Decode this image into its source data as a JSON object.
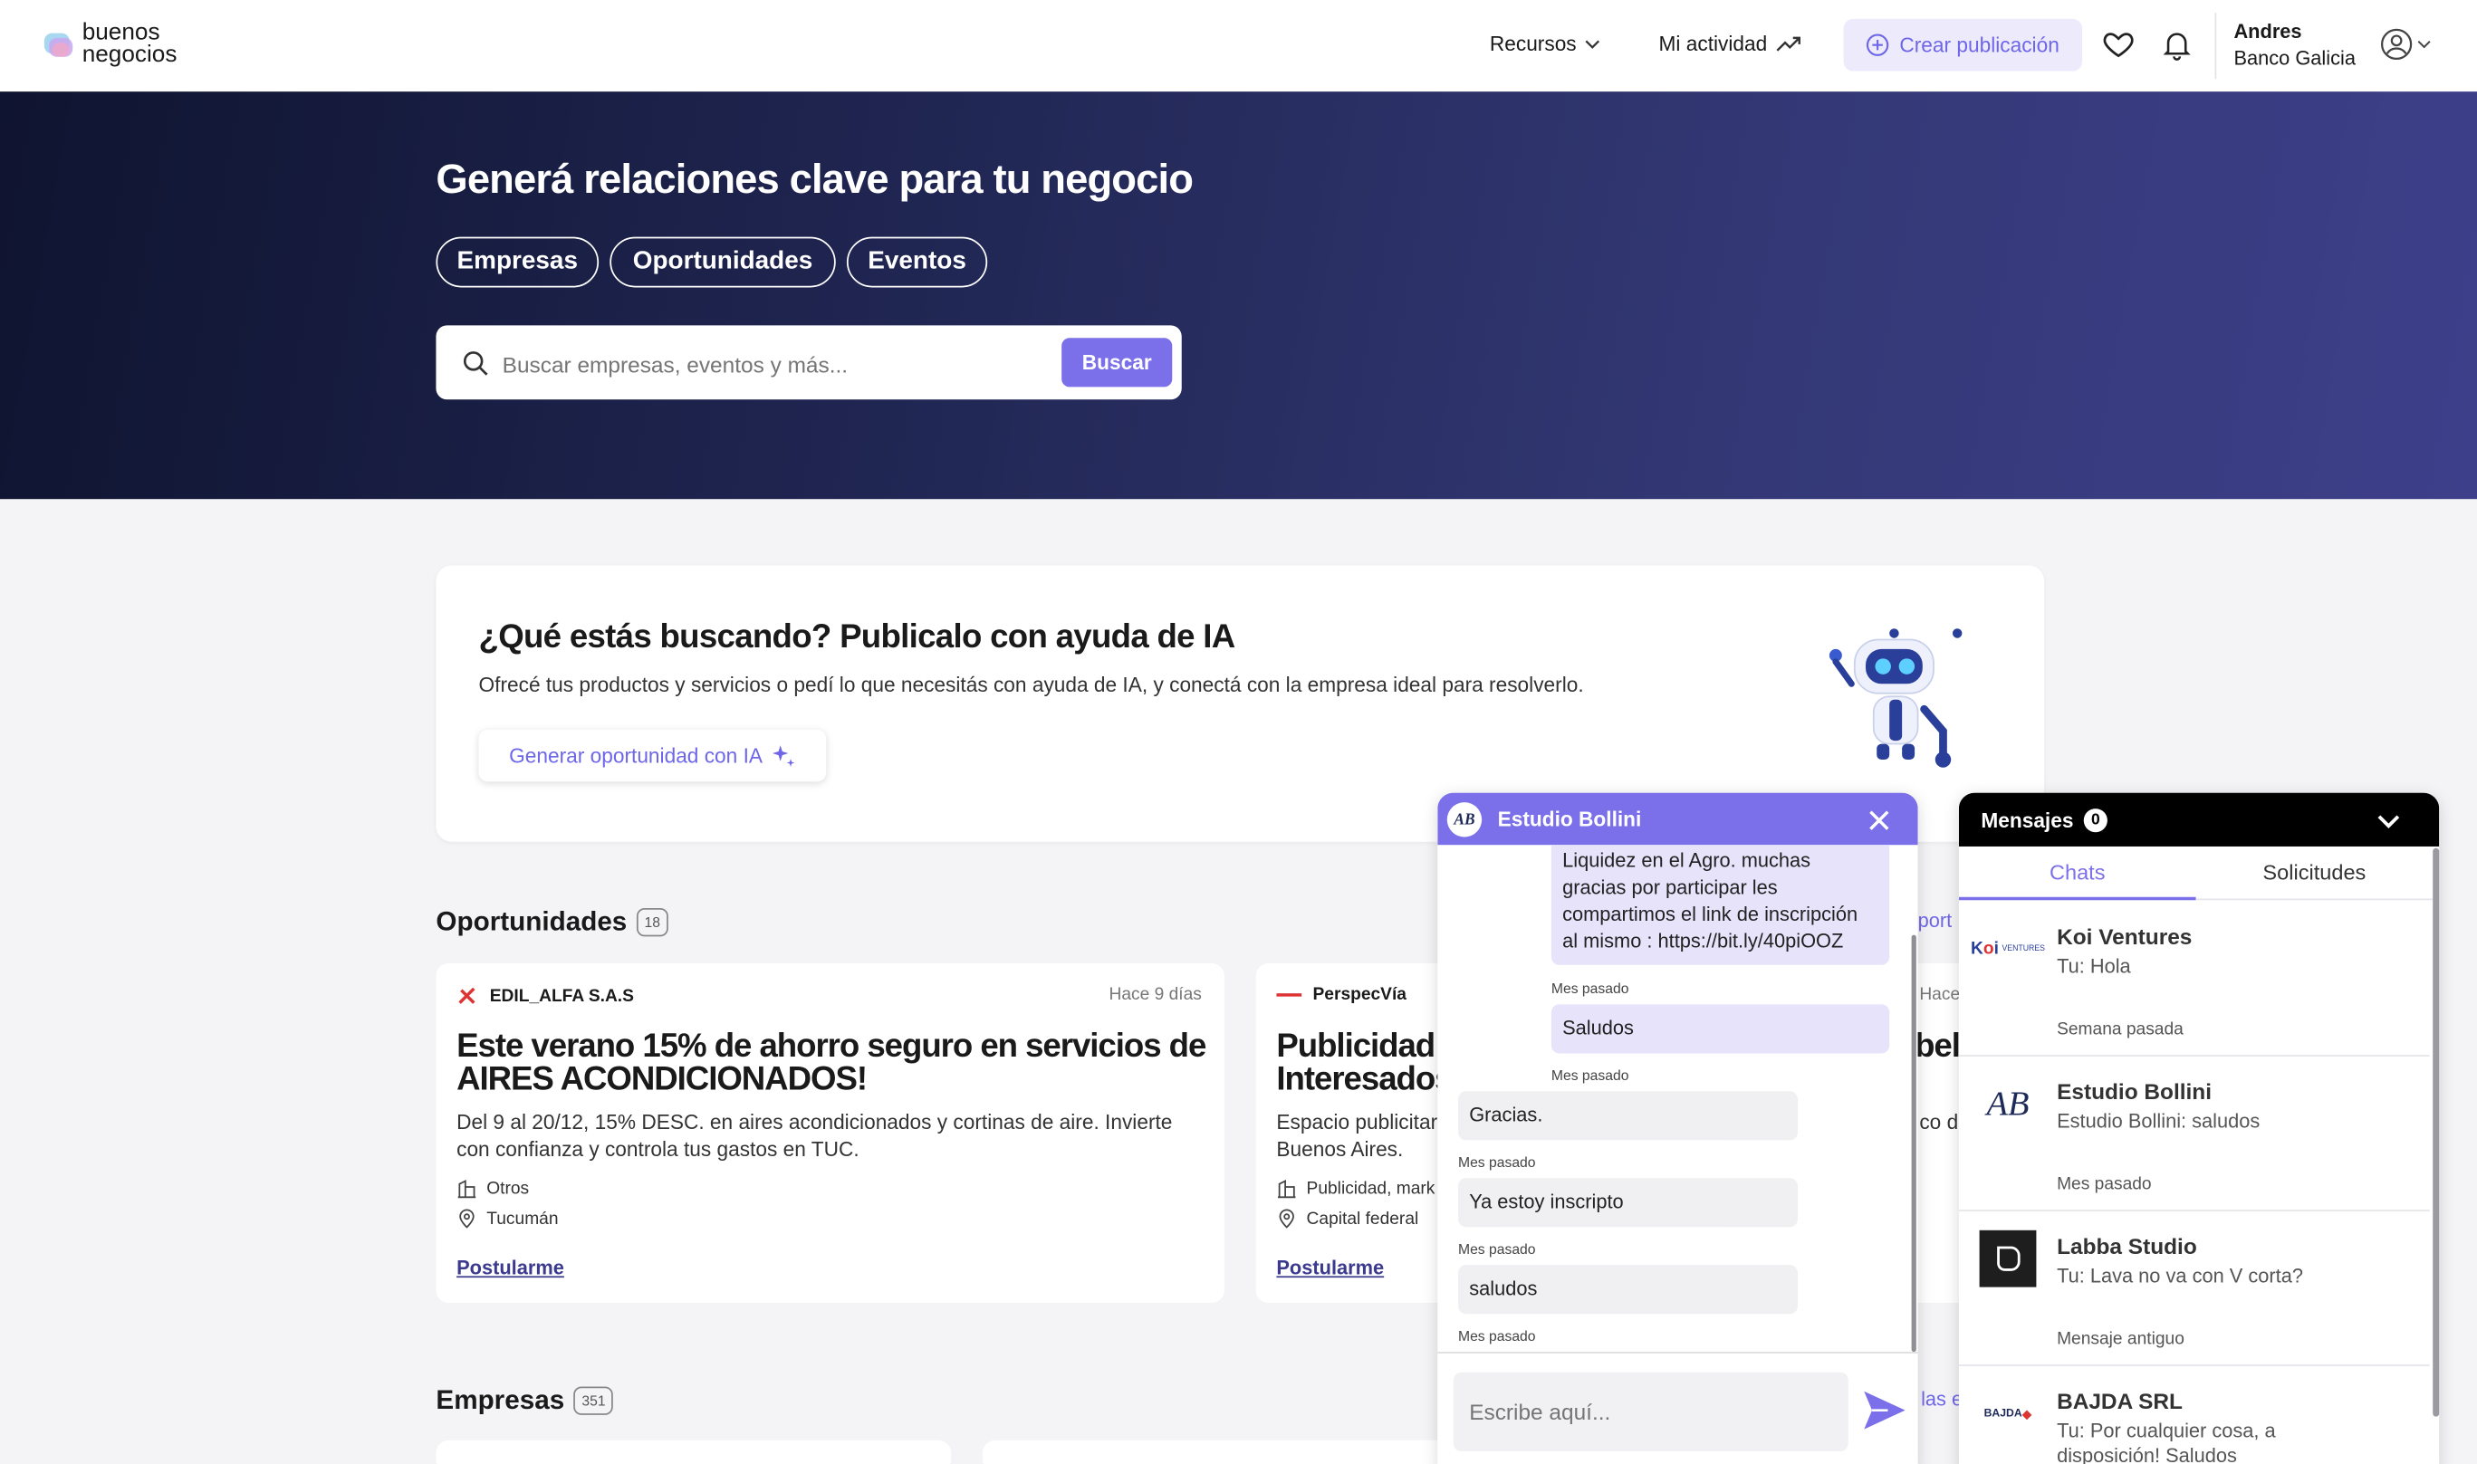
{
  "header": {
    "logo_line1": "buenos",
    "logo_line2": "negocios",
    "nav_resources": "Recursos",
    "nav_activity": "Mi actividad",
    "create_label": "Crear publicación",
    "user_name": "Andres",
    "user_company": "Banco Galicia"
  },
  "hero": {
    "title": "Generá relaciones clave para tu negocio",
    "tabs": [
      "Empresas",
      "Oportunidades",
      "Eventos"
    ],
    "search_placeholder": "Buscar empresas, eventos y más...",
    "search_button": "Buscar"
  },
  "ai_card": {
    "title": "¿Qué estás buscando? Publicalo con ayuda de IA",
    "description": "Ofrecé tus productos y servicios o pedí lo que necesitás con ayuda de IA, y conectá con la empresa ideal para resolverlo.",
    "button_label": "Generar oportunidad con IA"
  },
  "opportunities": {
    "title": "Oportunidades",
    "count": "18",
    "see_all_partial": "port",
    "cards": [
      {
        "company": "EDIL_ALFA S.A.S",
        "time": "Hace 9 días",
        "title_line1": "Este verano 15% de ahorro seguro en servicios de",
        "title_line2": "AIRES ACONDICIONADOS!",
        "desc_line1": "Del 9 al 20/12, 15% DESC. en aires acondicionados y cortinas de aire. Invierte",
        "desc_line2": "con confianza y controla tus gastos en TUC.",
        "category": "Otros",
        "location": "Tucumán",
        "cta": "Postularme"
      },
      {
        "company": "PerspecVía",
        "time": "Hace",
        "title_line1": "Publicidad",
        "title_line1_right": "bel",
        "title_line2": "Interesados",
        "desc_line1": "Espacio publicitar",
        "desc_line1_right": "co de",
        "desc_line2": "Buenos Aires.",
        "category": "Publicidad, mark",
        "location": "Capital federal",
        "cta": "Postularme"
      }
    ]
  },
  "companies": {
    "title": "Empresas",
    "count": "351",
    "see_all_partial": "las e"
  },
  "chat": {
    "contact": "Estudio Bollini",
    "messages": [
      {
        "dir": "out",
        "text_lines": [
          "Liquidez en el Agro. muchas",
          "gracias por participar les",
          "compartimos el link de inscripción",
          "al mismo : https://bit.ly/40piOOZ"
        ],
        "stamp": "Mes pasado"
      },
      {
        "dir": "out",
        "text": "Saludos",
        "stamp": "Mes pasado"
      },
      {
        "dir": "in",
        "text": "Gracias.",
        "stamp": "Mes pasado"
      },
      {
        "dir": "in",
        "text": "Ya estoy inscripto",
        "stamp": "Mes pasado"
      },
      {
        "dir": "in",
        "text": "saludos",
        "stamp": "Mes pasado"
      }
    ],
    "input_placeholder": "Escribe aquí..."
  },
  "messages_panel": {
    "title": "Mensajes",
    "unread": "0",
    "tabs": [
      "Chats",
      "Solicitudes"
    ],
    "active_tab": "Chats",
    "rows": [
      {
        "name": "Koi Ventures",
        "preview": "Tu: Hola",
        "time": "Semana pasada"
      },
      {
        "name": "Estudio Bollini",
        "preview": "Estudio Bollini: saludos",
        "time": "Mes pasado"
      },
      {
        "name": "Labba Studio",
        "preview": "Tu: Lava no va con V corta?",
        "time": "Mensaje antiguo"
      },
      {
        "name": "BAJDA SRL",
        "preview": "Tu: Por cualquier cosa, a disposición! Saludos",
        "time": ""
      }
    ]
  },
  "colors": {
    "accent": "#7c70ea",
    "hero_dark": "#0f1430",
    "hero_light": "#3e3f8a",
    "link": "#3b3a8f"
  }
}
